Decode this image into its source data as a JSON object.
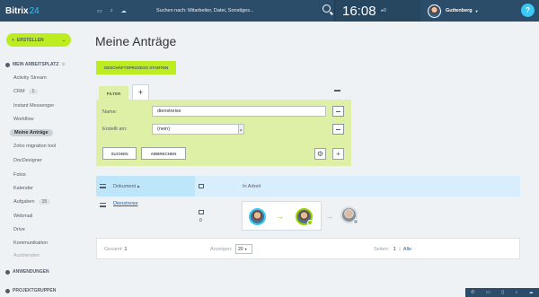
{
  "topbar": {
    "logo": "Bitrix",
    "logo_num": "24",
    "search_text": "Suchen nach: Mitarbeiter, Datei, Sonstiges...",
    "time": "16:08",
    "flag": "▸0",
    "user_name": "Guttenberg",
    "help": "?"
  },
  "sidebar": {
    "create_label": "ERSTELLEN",
    "section_workspace": "MEIN ARBEITSPLATZ",
    "items": [
      {
        "label": "Activity Stream"
      },
      {
        "label": "CRM",
        "badge": "1"
      },
      {
        "label": "Instant Messenger"
      },
      {
        "label": "Workflow"
      },
      {
        "label": "Meine Anträge"
      },
      {
        "label": "Zoho migration tool"
      },
      {
        "label": "DocDesigner"
      },
      {
        "label": "Fotos"
      },
      {
        "label": "Kalender"
      },
      {
        "label": "Aufgaben",
        "badge": "15"
      },
      {
        "label": "Webmail"
      },
      {
        "label": "Drive"
      },
      {
        "label": "Kommunikation"
      },
      {
        "label": "Ausblenden"
      }
    ],
    "section_apps": "ANWENDUNGEN",
    "section_groups": "PROJEKTGRUPPEN"
  },
  "main": {
    "title": "Meine Anträge",
    "start_button": "GESCHÄFTSPROZESS STARTEN",
    "filter_tab": "FILTER",
    "filter": {
      "name_label": "Name:",
      "name_value": "dienstreise",
      "created_label": "Erstellt am:",
      "created_value": "(nein)",
      "search_button": "SUCHEN",
      "cancel_button": "ABBRECHEN"
    },
    "table": {
      "col_document": "Dokument",
      "col_in_work": "In Arbeit",
      "row": {
        "document": "Dienstreise",
        "count": "0"
      }
    },
    "footer": {
      "total_label": "Gesamt:",
      "total_value": "1",
      "show_label": "Anzeigen:",
      "show_value": "20",
      "pages_label": "Seiten:",
      "page_value": "1",
      "all_link": "Alle"
    }
  }
}
